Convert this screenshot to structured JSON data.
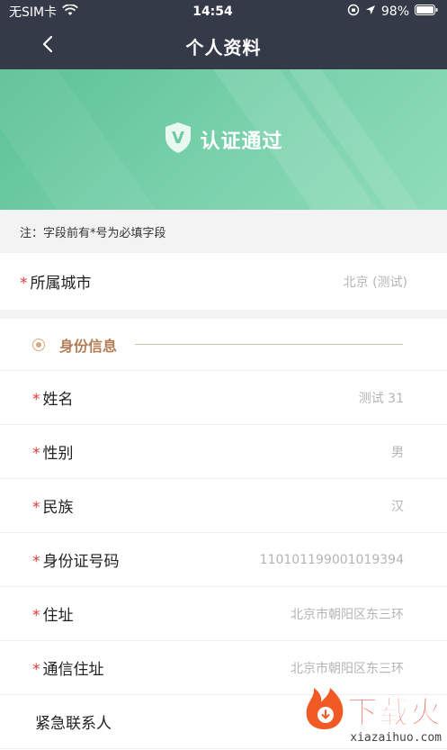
{
  "status_bar": {
    "carrier": "无SIM卡",
    "time": "14:54",
    "battery": "98%"
  },
  "nav": {
    "title": "个人资料",
    "back_icon": "chevron-left-icon"
  },
  "banner": {
    "badge_letter": "V",
    "text": "认证通过",
    "gradient": [
      "#5cc196",
      "#8fdcb9"
    ]
  },
  "note": "注：字段前有*号为必填字段",
  "city": {
    "required_mark": "*",
    "label": "所属城市",
    "value": "北京 (测试)"
  },
  "section": {
    "title": "身份信息",
    "accent": "#b37e56"
  },
  "fields": [
    {
      "required_mark": "*",
      "label": "姓名",
      "value": "测试 31"
    },
    {
      "required_mark": "*",
      "label": "性别",
      "value": "男"
    },
    {
      "required_mark": "*",
      "label": "民族",
      "value": "汉"
    },
    {
      "required_mark": "*",
      "label": "身份证号码",
      "value": "110101199001019394"
    },
    {
      "required_mark": "*",
      "label": "住址",
      "value": "北京市朝阳区东三环"
    },
    {
      "required_mark": "*",
      "label": "通信住址",
      "value": "北京市朝阳区东三环"
    },
    {
      "required_mark": "",
      "label": "紧急联系人",
      "value": ""
    }
  ],
  "watermark": {
    "text": "下载火",
    "url": "xiazaihuo.com"
  }
}
